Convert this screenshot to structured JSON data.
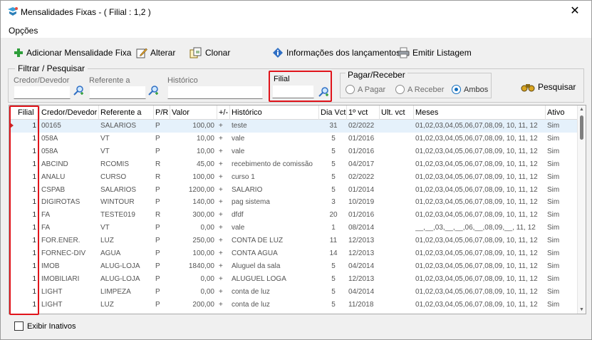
{
  "window": {
    "title": "Mensalidades Fixas - ( Filial : 1,2 )",
    "close_glyph": "✕"
  },
  "menu": {
    "opcoes": "Opções"
  },
  "toolbar": {
    "add": "Adicionar Mensalidade Fixa",
    "alterar": "Alterar",
    "clonar": "Clonar",
    "info": "Informações dos lançamentos",
    "emitir": "Emitir Listagem"
  },
  "filter": {
    "legend": "Filtrar / Pesquisar",
    "credor_label": "Credor/Devedor",
    "referente_label": "Referente a",
    "historico_label": "Histórico",
    "filial_label": "Filial",
    "pr_legend": "Pagar/Receber",
    "radio_pagar": "A Pagar",
    "radio_receber": "A Receber",
    "radio_ambos": "Ambos",
    "radio_selected": "Ambos",
    "pesquisar": "Pesquisar"
  },
  "grid": {
    "columns": [
      "Filial",
      "Credor/Devedor",
      "Referente a",
      "P/R",
      "Valor",
      "+/-",
      "Histórico",
      "Dia Vct",
      "1º vct",
      "Ult. vct",
      "Meses",
      "Ativo"
    ],
    "rows": [
      [
        "1",
        "00165",
        "SALARIOS",
        "P",
        "100,00",
        "+",
        "teste",
        "31",
        "02/2022",
        "",
        "01,02,03,04,05,06,07,08,09, 10, 11, 12",
        "Sim"
      ],
      [
        "1",
        "058A",
        "VT",
        "P",
        "10,00",
        "+",
        "vale",
        "5",
        "01/2016",
        "",
        "01,02,03,04,05,06,07,08,09, 10, 11, 12",
        "Sim"
      ],
      [
        "1",
        "058A",
        "VT",
        "P",
        "10,00",
        "+",
        "vale",
        "5",
        "01/2016",
        "",
        "01,02,03,04,05,06,07,08,09, 10, 11, 12",
        "Sim"
      ],
      [
        "1",
        "ABCIND",
        "RCOMIS",
        "R",
        "45,00",
        "+",
        "recebimento de comissão",
        "5",
        "04/2017",
        "",
        "01,02,03,04,05,06,07,08,09, 10, 11, 12",
        "Sim"
      ],
      [
        "1",
        "ANALU",
        "CURSO",
        "R",
        "100,00",
        "+",
        "curso 1",
        "5",
        "02/2022",
        "",
        "01,02,03,04,05,06,07,08,09, 10, 11, 12",
        "Sim"
      ],
      [
        "1",
        "CSPAB",
        "SALARIOS",
        "P",
        "1200,00",
        "+",
        "SALÁRIO",
        "5",
        "01/2014",
        "",
        "01,02,03,04,05,06,07,08,09, 10, 11, 12",
        "Sim"
      ],
      [
        "1",
        "DIGIROTAS",
        "WINTOUR",
        "P",
        "140,00",
        "+",
        "pag sistema",
        "3",
        "10/2019",
        "",
        "01,02,03,04,05,06,07,08,09, 10, 11, 12",
        "Sim"
      ],
      [
        "1",
        "FA",
        "TESTE019",
        "R",
        "300,00",
        "+",
        "dfdf",
        "20",
        "01/2016",
        "",
        "01,02,03,04,05,06,07,08,09, 10, 11, 12",
        "Sim"
      ],
      [
        "1",
        "FA",
        "VT",
        "P",
        "0,00",
        "+",
        "vale",
        "1",
        "08/2014",
        "",
        "__,__,03,__,__,06,__,08,09,__, 11, 12",
        "Sim"
      ],
      [
        "1",
        "FOR.ENER.",
        "LUZ",
        "P",
        "250,00",
        "+",
        "CONTA DE LUZ",
        "11",
        "12/2013",
        "",
        "01,02,03,04,05,06,07,08,09, 10, 11, 12",
        "Sim"
      ],
      [
        "1",
        "FORNEC-DIV",
        "AGUA",
        "P",
        "100,00",
        "+",
        "CONTA ÁGUA",
        "14",
        "12/2013",
        "",
        "01,02,03,04,05,06,07,08,09, 10, 11, 12",
        "Sim"
      ],
      [
        "1",
        "IMOB",
        "ALUG-LOJA",
        "P",
        "1840,00",
        "+",
        "Aluguel da sala",
        "5",
        "04/2014",
        "",
        "01,02,03,04,05,06,07,08,09, 10, 11, 12",
        "Sim"
      ],
      [
        "1",
        "IMOBILIARI",
        "ALUG-LOJA",
        "P",
        "0,00",
        "+",
        "ALUGUEL LOGA",
        "5",
        "12/2013",
        "",
        "01,02,03,04,05,06,07,08,09, 10, 11, 12",
        "Sim"
      ],
      [
        "1",
        "LIGHT",
        "LIMPEZA",
        "P",
        "0,00",
        "+",
        "conta de luz",
        "5",
        "04/2014",
        "",
        "01,02,03,04,05,06,07,08,09, 10, 11, 12",
        "Sim"
      ],
      [
        "1",
        "LIGHT",
        "LUZ",
        "P",
        "200,00",
        "+",
        "conta de luz",
        "5",
        "11/2018",
        "",
        "01,02,03,04,05,06,07,08,09, 10, 11, 12",
        "Sim"
      ]
    ]
  },
  "footer": {
    "exibir_inativos": "Exibir Inativos"
  },
  "colors": {
    "highlight_border": "#e0141b",
    "selected_row": "#e5f1fb",
    "radio_accent": "#0f6cbd"
  }
}
